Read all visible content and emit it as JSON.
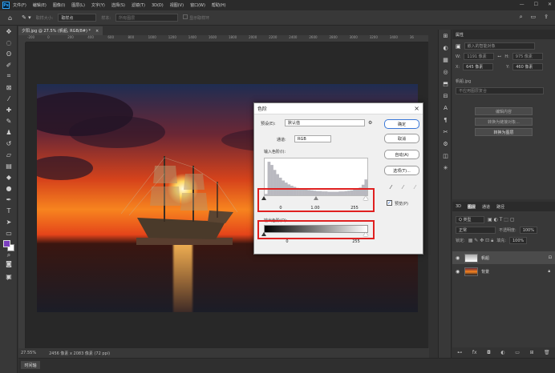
{
  "app": {
    "logo": "Ps",
    "menu": [
      "文件(F)",
      "编辑(E)",
      "图像(I)",
      "图层(L)",
      "文字(Y)",
      "选择(S)",
      "滤镜(T)",
      "3D(D)",
      "视图(V)",
      "窗口(W)",
      "帮助(H)"
    ],
    "window_controls": [
      "—",
      "☐",
      "✕"
    ]
  },
  "options_bar": {
    "sample_size_label": "取样大小:",
    "sample_size_value": "取样点",
    "sample_label": "样本:",
    "sample_value": "所有图层",
    "show_ring_label": "显示取样环"
  },
  "document": {
    "tab_title": "夕阳.jpg @ 27.5% (帆船, RGB/8#) *",
    "tab_close": "×",
    "ruler_ticks": [
      "-200",
      "0",
      "200",
      "400",
      "600",
      "800",
      "1000",
      "1200",
      "1400",
      "1600",
      "1800",
      "2000",
      "2200",
      "2400",
      "2600",
      "2800",
      "3000",
      "3200",
      "3400",
      "36"
    ],
    "zoom": "27.55%",
    "doc_info": "2456 像素 x 2083 像素 (72 ppi)",
    "timeline_tab": "时间轴"
  },
  "properties": {
    "tab": "属性",
    "layer_type": "嵌入的智能对象",
    "w_label": "W:",
    "w_value": "1191 像素",
    "h_label": "H:",
    "h_value": "975 像素",
    "x_label": "X:",
    "x_value": "645 像素",
    "y_label": "Y:",
    "y_value": "460 像素",
    "source_file": "帆船.jpg",
    "comp_placeholder": "不应用图层复合",
    "btn_edit": "编辑内容",
    "btn_convert_link": "转换为链接对象...",
    "btn_convert_layers": "转换为图层"
  },
  "layers_panel": {
    "tabs": [
      "3D",
      "图层",
      "通道",
      "路径"
    ],
    "active_tab": "图层",
    "kind_filter": "Q 类型",
    "blend_mode": "正常",
    "opacity_label": "不透明度:",
    "opacity_value": "100%",
    "lock_label": "锁定:",
    "fill_label": "填充:",
    "fill_value": "100%",
    "layers": [
      {
        "name": "帆船",
        "selected": true
      },
      {
        "name": "背景",
        "selected": false
      }
    ],
    "footer_icons": [
      "link-icon",
      "fx-icon",
      "mask-icon",
      "adjustment-icon",
      "folder-icon",
      "new-layer-icon",
      "trash-icon"
    ]
  },
  "levels_dialog": {
    "title": "色阶",
    "close": "×",
    "preset_label": "预设(E):",
    "preset_value": "默认值",
    "channel_label": "通道:",
    "channel_value": "RGB",
    "input_label": "输入色阶(I):",
    "input_black": "0",
    "input_gamma": "1.00",
    "input_white": "255",
    "output_label": "输出色阶(O):",
    "output_black": "0",
    "output_white": "255",
    "btn_ok": "确定",
    "btn_cancel": "取消",
    "btn_auto": "自动(A)",
    "btn_options": "选项(T)...",
    "preview_label": "预览(P)",
    "preview_checked": true,
    "histogram_levels": [
      0.04,
      0.95,
      0.86,
      0.72,
      0.6,
      0.5,
      0.42,
      0.36,
      0.31,
      0.27,
      0.24,
      0.21,
      0.19,
      0.17,
      0.16,
      0.15,
      0.14,
      0.13,
      0.12,
      0.12,
      0.11,
      0.11,
      0.1,
      0.1,
      0.1,
      0.1,
      0.11,
      0.11,
      0.12,
      0.13,
      0.14,
      0.16,
      0.18,
      0.22,
      0.3,
      0.45
    ]
  },
  "colors": {
    "foreground": "#7b3fbf",
    "background": "#ffffff",
    "highlight_box": "#e02020",
    "accent": "#31a8ff"
  }
}
